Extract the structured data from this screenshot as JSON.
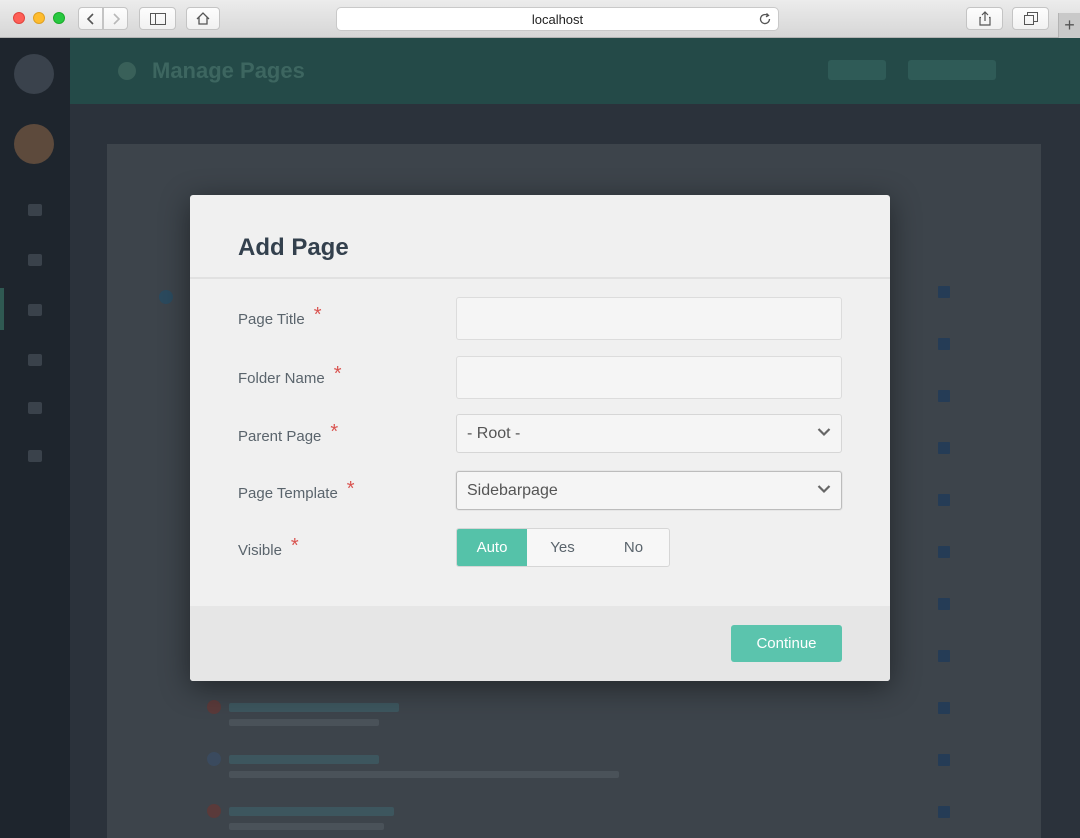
{
  "browser": {
    "url": "localhost"
  },
  "app": {
    "header_title": "Manage Pages"
  },
  "modal": {
    "title": "Add Page",
    "fields": {
      "page_title": {
        "label": "Page Title",
        "value": "",
        "required_mark": "*"
      },
      "folder_name": {
        "label": "Folder Name",
        "value": "",
        "required_mark": "*"
      },
      "parent_page": {
        "label": "Parent Page",
        "selected": "- Root -",
        "required_mark": "*"
      },
      "page_template": {
        "label": "Page Template",
        "selected": "Sidebarpage",
        "required_mark": "*"
      },
      "visible": {
        "label": "Visible",
        "required_mark": "*",
        "options": [
          "Auto",
          "Yes",
          "No"
        ],
        "selected": "Auto"
      }
    },
    "continue_label": "Continue"
  },
  "colors": {
    "accent": "#55c2a9",
    "required": "#d9534f",
    "title": "#33404d"
  }
}
